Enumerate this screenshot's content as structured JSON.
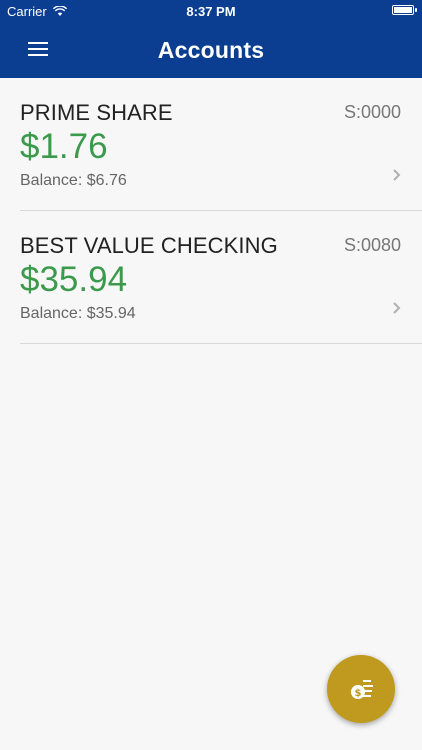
{
  "status": {
    "carrier": "Carrier",
    "time": "8:37 PM"
  },
  "header": {
    "title": "Accounts",
    "menu_icon": "hamburger-menu-icon"
  },
  "accounts": [
    {
      "name": "PRIME SHARE",
      "id": "S:0000",
      "amount": "$1.76",
      "balance": "Balance: $6.76"
    },
    {
      "name": "BEST VALUE CHECKING",
      "id": "S:0080",
      "amount": "$35.94",
      "balance": "Balance: $35.94"
    }
  ],
  "colors": {
    "header_bg": "#0b3d91",
    "amount": "#3c9a4c",
    "fab_bg": "#bf9a1f"
  },
  "fab": {
    "icon": "transfer-money-icon"
  }
}
